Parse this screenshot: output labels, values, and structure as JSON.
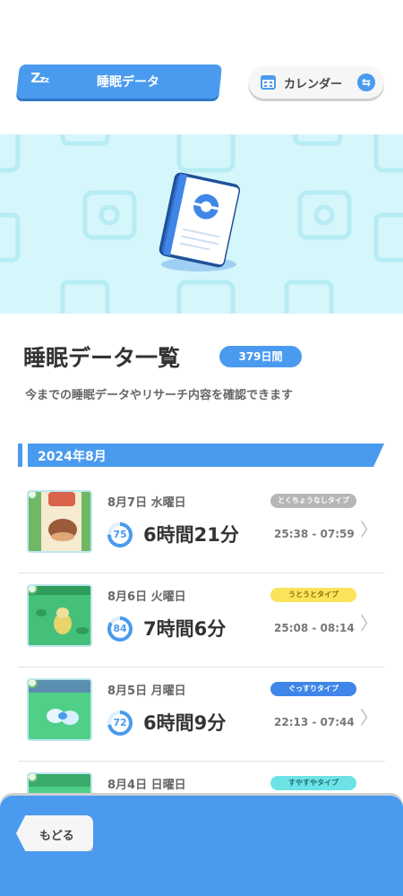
{
  "header": {
    "sleep_tab_label": "睡眠データ",
    "sleep_tab_icon": "zzz-icon",
    "calendar_label": "カレンダー",
    "calendar_icon": "calendar-icon",
    "swap_icon": "swap-icon"
  },
  "colors": {
    "accent": "#4a9bef",
    "banner_bg": "#d5f6fb"
  },
  "list": {
    "title": "睡眠データ一覧",
    "days_badge": "379日間",
    "subtitle": "今までの睡眠データやリサーチ内容を確認できます"
  },
  "month": "2024年8月",
  "entries": [
    {
      "date": "8月7日 水曜日",
      "type": "とくちょうなしタイプ",
      "type_color": "#b6b6b6",
      "score": "75",
      "score_fraction": 0.75,
      "duration": "6時間21分",
      "range": "25:38 - 07:59"
    },
    {
      "date": "8月6日 火曜日",
      "type": "うとうとタイプ",
      "type_color": "#fbe35a",
      "score": "84",
      "score_fraction": 0.84,
      "duration": "7時間6分",
      "range": "25:08 - 08:14"
    },
    {
      "date": "8月5日 月曜日",
      "type": "ぐっすりタイプ",
      "type_color": "#3f86e8",
      "score": "72",
      "score_fraction": 0.72,
      "duration": "6時間9分",
      "range": "22:13 - 07:44"
    },
    {
      "date": "8月4日 日曜日",
      "type": "すやすやタイプ",
      "type_color": "#6de3e6"
    }
  ],
  "footer": {
    "back_label": "もどる"
  }
}
